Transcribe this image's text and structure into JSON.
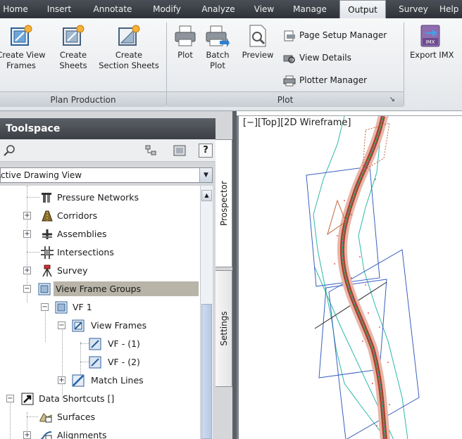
{
  "ribbon": {
    "tabs": [
      "Home",
      "Insert",
      "Annotate",
      "Modify",
      "Analyze",
      "View",
      "Manage",
      "Output",
      "Survey",
      "Help"
    ],
    "active_tab": "Output",
    "plan_production": {
      "buttons": [
        {
          "line1": "Create View",
          "line2": "Frames"
        },
        {
          "line1": "Create",
          "line2": "Sheets"
        },
        {
          "line1": "Create",
          "line2": "Section Sheets"
        }
      ],
      "title": "Plan Production"
    },
    "plot": {
      "plot_label": "Plot",
      "batch_line1": "Batch",
      "batch_line2": "Plot",
      "preview_label": "Preview",
      "page_setup": "Page Setup Manager",
      "view_details": "View Details",
      "plotter_manager": "Plotter Manager",
      "title": "Plot",
      "launcher_glyph": "↘"
    },
    "export": {
      "label": "Export IMX",
      "icon_text": "IMX"
    }
  },
  "toolspace": {
    "title": "Toolspace",
    "view_select": "Active Drawing View",
    "help_label": "?",
    "tabs": [
      "Prospector",
      "Settings"
    ],
    "tree": [
      {
        "label": "Pressure Networks",
        "icon": "pressure-networks-icon"
      },
      {
        "label": "Corridors",
        "icon": "corridors-icon"
      },
      {
        "label": "Assemblies",
        "icon": "assemblies-icon"
      },
      {
        "label": "Intersections",
        "icon": "intersections-icon"
      },
      {
        "label": "Survey",
        "icon": "survey-icon"
      },
      {
        "label": "View Frame Groups",
        "icon": "view-frame-groups-icon"
      },
      {
        "label": "VF 1",
        "icon": "view-frame-group-icon"
      },
      {
        "label": "View Frames",
        "icon": "view-frames-icon"
      },
      {
        "label": "VF - (1)",
        "icon": "view-frame-icon"
      },
      {
        "label": "VF - (2)",
        "icon": "view-frame-icon"
      },
      {
        "label": "Match Lines",
        "icon": "match-lines-icon"
      },
      {
        "label": "Data Shortcuts []",
        "icon": "data-shortcuts-icon"
      },
      {
        "label": "Surfaces",
        "icon": "surfaces-icon"
      },
      {
        "label": "Alignments",
        "icon": "alignments-icon"
      }
    ]
  },
  "viewport": {
    "label": "[−][Top][2D Wireframe]"
  },
  "colors": {
    "tabbar": "#3a3e44",
    "selected_row": "#b8b4a8",
    "corridor": "#b33a2a",
    "frame_lines": "#3a5fbf",
    "boundary": "#2bb9a6"
  }
}
